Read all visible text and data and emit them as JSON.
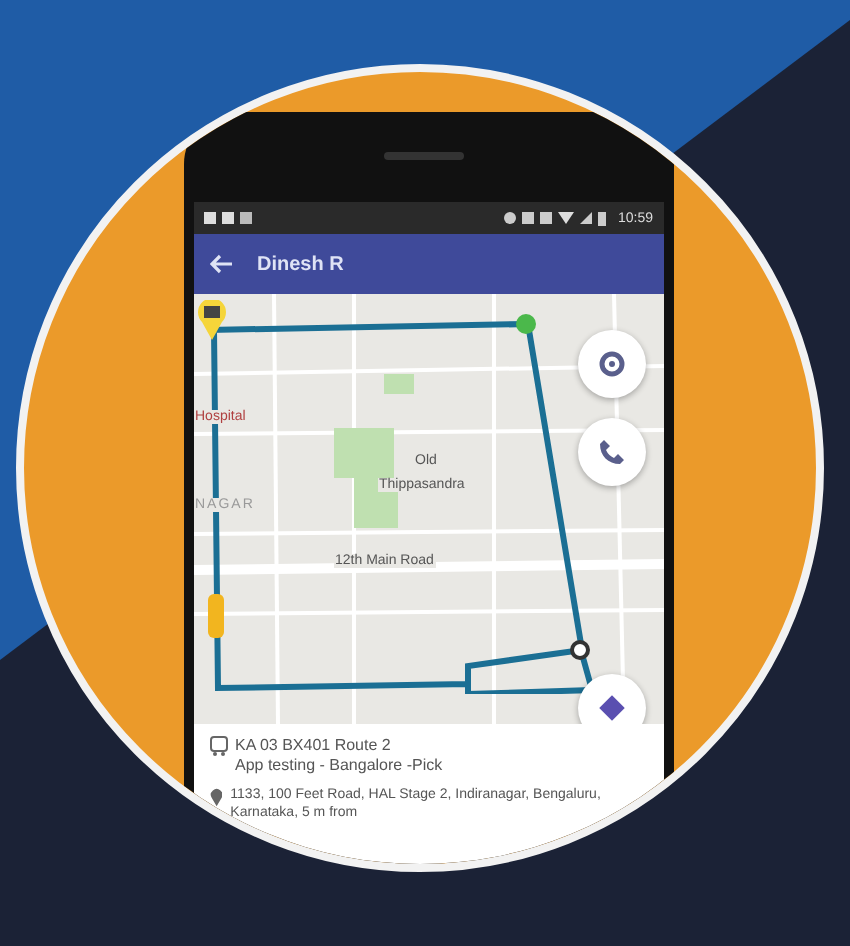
{
  "status_bar": {
    "time": "10:59"
  },
  "app_bar": {
    "title": "Dinesh R"
  },
  "map": {
    "labels": [
      "Hospital",
      "NAGAR",
      "Old",
      "Thippasandra",
      "12th Main Road"
    ]
  },
  "trip": {
    "vehicle": "KA 03 BX401 Route 2",
    "route": "App testing - Bangalore -Pick",
    "address": "1133, 100 Feet Road, HAL Stage 2, Indiranagar, Bengaluru, Karnataka, 5 m from"
  }
}
